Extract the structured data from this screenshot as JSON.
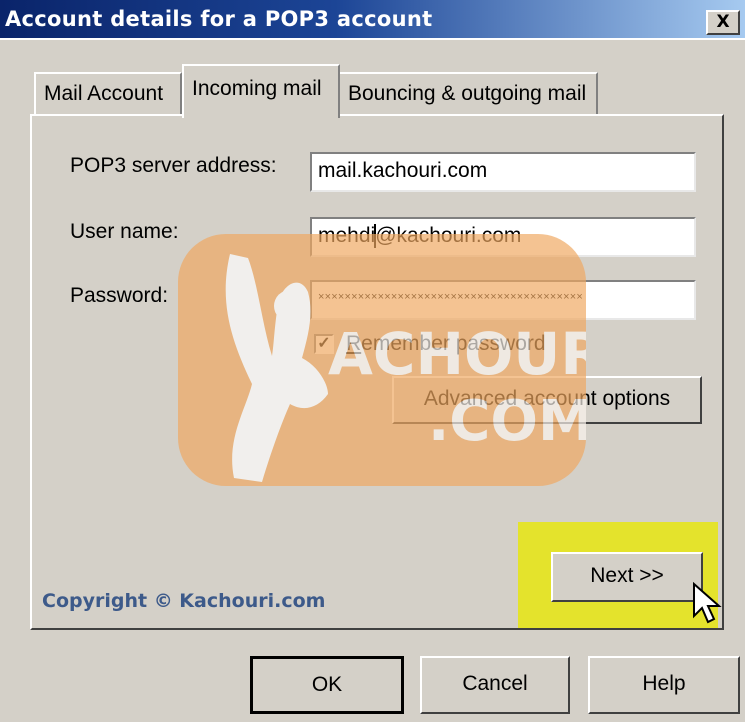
{
  "window": {
    "title": "Account details for a POP3 account",
    "close_label": "X"
  },
  "tabs": [
    {
      "label": "Mail Account",
      "active": false
    },
    {
      "label": "Incoming mail",
      "active": true
    },
    {
      "label": "Bouncing & outgoing mail",
      "active": false
    }
  ],
  "form": {
    "server_label": "POP3 server address:",
    "server_value": "mail.kachouri.com",
    "username_label": "User name:",
    "username_value_prefix": "mehdi",
    "username_value_suffix": "@kachouri.com",
    "password_label": "Password:",
    "password_value": "××××××××××××××××××××××××××××××××××××××××",
    "remember_prefix": "R",
    "remember_rest": "emember password",
    "remember_checked": true,
    "advanced_button": "Advanced account options",
    "next_button": "Next >>"
  },
  "watermark": {
    "logo": "KACHOURI .COM",
    "copyright": "Copyright © Kachouri.com"
  },
  "dialog_buttons": {
    "ok": "OK",
    "cancel": "Cancel",
    "help": "Help"
  },
  "colors": {
    "title_start": "#0a246a",
    "title_end": "#a6caf0",
    "face": "#d4d0c8",
    "highlight": "#e8e800",
    "copyright": "#3d5a8a"
  }
}
